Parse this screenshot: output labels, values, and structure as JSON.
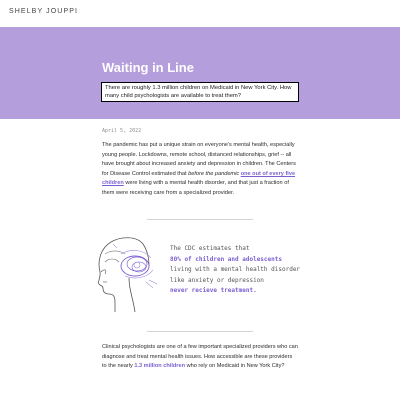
{
  "site": {
    "name": "SHELBY JOUPPI"
  },
  "hero": {
    "title": "Waiting in Line",
    "subtitle": "There are roughly 1.3 million children on Medicaid in New York City. How many child psychologists are available to treat them?"
  },
  "article": {
    "date": "April 5, 2022",
    "para1": {
      "text_a": "The pandemic has put a unique strain on everyone's mental health, especially young people. Lockdowns, remote school, distanced relationships, grief -- all have brought about increased anxiety and depression in children. The Centers for Disease Control estimated that ",
      "emph": "before the pandemic",
      "space": " ",
      "highlight": "one out of every five children",
      "text_b": " were living with a mental health disorder, and that just a fraction of them were receiving care from a specialized provider."
    },
    "callout": {
      "line1": "The CDC estimates that",
      "line2": "80% of children and adolescents",
      "line3": "living with a mental health disorder",
      "line4": "like anxiety or depression",
      "line5": "never recieve treatment."
    },
    "para2": {
      "text_a": "Clinical psychologists are one of a few important specialized providers who can diagnose and treat mental health issues. How accessible are these providers to the nearly ",
      "highlight": "1.3 million children",
      "text_b": " who rely on Medicaid in New York City?"
    }
  },
  "colors": {
    "hero_bg": "#b49fdc",
    "accent": "#7b5fd0"
  },
  "icons": {
    "illustration": "child-head-with-scribble-icon"
  }
}
